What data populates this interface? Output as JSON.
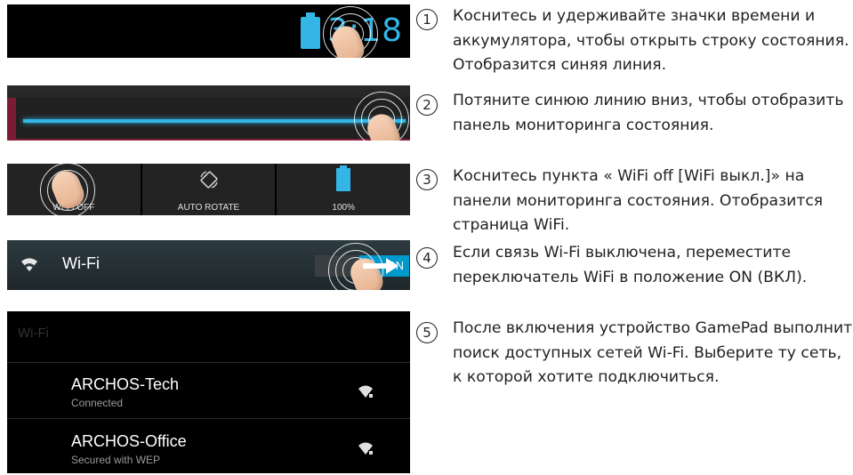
{
  "panel1": {
    "time": "3:18"
  },
  "panel3": {
    "tiles": [
      {
        "label": "WI-FI OFF"
      },
      {
        "label": "AUTO ROTATE"
      },
      {
        "label": "100%"
      }
    ]
  },
  "panel4": {
    "label": "Wi-Fi",
    "switch_text": "ON"
  },
  "panel5": {
    "header": "Wi-Fi",
    "networks": [
      {
        "name": "ARCHOS-Tech",
        "status": "Connected"
      },
      {
        "name": "ARCHOS-Office",
        "status": "Secured with WEP"
      }
    ]
  },
  "steps": [
    {
      "number": "1",
      "text": "Коснитесь и удерживайте значки времени и аккумулятора, чтобы открыть строку состояния. Отобразится синяя линия."
    },
    {
      "number": "2",
      "text": "Потяните синюю линию вниз, чтобы отобразить панель мониторинга состояния."
    },
    {
      "number": "3",
      "text": "Коснитесь пункта « WiFi off [WiFi выкл.]» на панели мониторинга состояния. Отобразится страница WiFi."
    },
    {
      "number": "4",
      "text": "Если связь Wi-Fi выключена, переместите переключатель WiFi в положение ON (ВКЛ)."
    },
    {
      "number": "5",
      "text": "После включения устройство GamePad выполнит поиск доступных сетей Wi-Fi. Выберите ту сеть, к которой хотите подключиться."
    }
  ],
  "colors": {
    "accent": "#33b5e5",
    "text": "#231f20"
  }
}
